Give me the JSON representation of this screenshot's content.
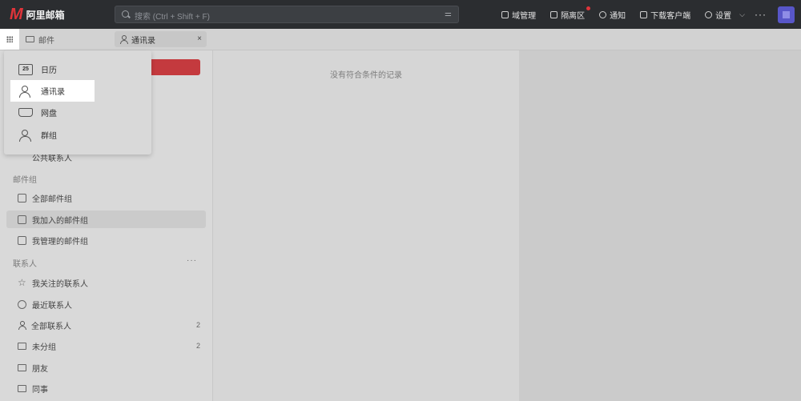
{
  "app": {
    "logo_mark": "M",
    "logo_text": "阿里邮箱"
  },
  "search": {
    "placeholder": "搜索 (Ctrl + Shift + F)",
    "advanced_icon": "filter-icon"
  },
  "top_actions": [
    {
      "label": "域管理",
      "icon": "wrench-icon"
    },
    {
      "label": "隔离区",
      "icon": "shield-icon",
      "dot": true
    },
    {
      "label": "通知",
      "icon": "bell-icon"
    },
    {
      "label": "下载客户端",
      "icon": "download-icon"
    },
    {
      "label": "设置",
      "icon": "gear-icon"
    }
  ],
  "more_label": "···",
  "tabs": {
    "mail": "邮件",
    "contacts": "通讯录",
    "close": "×"
  },
  "apps_menu": {
    "items": [
      {
        "label": "日历",
        "icon": "calendar-icon",
        "icon_text": "25"
      },
      {
        "label": "通讯录",
        "icon": "contacts-icon",
        "active": true
      },
      {
        "label": "网盘",
        "icon": "drive-icon"
      },
      {
        "label": "群组",
        "icon": "group-icon"
      }
    ]
  },
  "sidebar": {
    "public_contacts": "公共联系人",
    "mail_groups_title": "邮件组",
    "mail_groups": [
      {
        "label": "全部邮件组"
      },
      {
        "label": "我加入的邮件组",
        "active": true
      },
      {
        "label": "我管理的邮件组"
      }
    ],
    "contacts_title": "联系人",
    "contacts_more": "···",
    "contacts": [
      {
        "label": "我关注的联系人",
        "icon": "star-icon",
        "count": ""
      },
      {
        "label": "最近联系人",
        "icon": "clock-icon",
        "count": ""
      },
      {
        "label": "全部联系人",
        "icon": "person-icon",
        "count": "2"
      },
      {
        "label": "未分组",
        "icon": "folder-icon",
        "count": "2"
      },
      {
        "label": "朋友",
        "icon": "folder-icon",
        "count": ""
      },
      {
        "label": "同事",
        "icon": "folder-icon",
        "count": ""
      }
    ]
  },
  "content": {
    "empty_text": "没有符合条件的记录"
  },
  "colors": {
    "topbar": "#2b2d30",
    "brand_red": "#c43a3e",
    "avatar": "#5856c8"
  }
}
